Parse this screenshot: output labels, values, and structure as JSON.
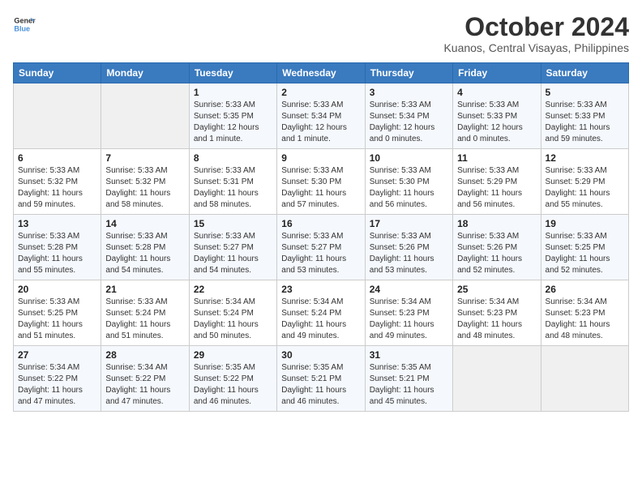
{
  "header": {
    "logo_line1": "General",
    "logo_line2": "Blue",
    "month": "October 2024",
    "location": "Kuanos, Central Visayas, Philippines"
  },
  "weekdays": [
    "Sunday",
    "Monday",
    "Tuesday",
    "Wednesday",
    "Thursday",
    "Friday",
    "Saturday"
  ],
  "weeks": [
    [
      {
        "day": "",
        "info": ""
      },
      {
        "day": "",
        "info": ""
      },
      {
        "day": "1",
        "info": "Sunrise: 5:33 AM\nSunset: 5:35 PM\nDaylight: 12 hours\nand 1 minute."
      },
      {
        "day": "2",
        "info": "Sunrise: 5:33 AM\nSunset: 5:34 PM\nDaylight: 12 hours\nand 1 minute."
      },
      {
        "day": "3",
        "info": "Sunrise: 5:33 AM\nSunset: 5:34 PM\nDaylight: 12 hours\nand 0 minutes."
      },
      {
        "day": "4",
        "info": "Sunrise: 5:33 AM\nSunset: 5:33 PM\nDaylight: 12 hours\nand 0 minutes."
      },
      {
        "day": "5",
        "info": "Sunrise: 5:33 AM\nSunset: 5:33 PM\nDaylight: 11 hours\nand 59 minutes."
      }
    ],
    [
      {
        "day": "6",
        "info": "Sunrise: 5:33 AM\nSunset: 5:32 PM\nDaylight: 11 hours\nand 59 minutes."
      },
      {
        "day": "7",
        "info": "Sunrise: 5:33 AM\nSunset: 5:32 PM\nDaylight: 11 hours\nand 58 minutes."
      },
      {
        "day": "8",
        "info": "Sunrise: 5:33 AM\nSunset: 5:31 PM\nDaylight: 11 hours\nand 58 minutes."
      },
      {
        "day": "9",
        "info": "Sunrise: 5:33 AM\nSunset: 5:30 PM\nDaylight: 11 hours\nand 57 minutes."
      },
      {
        "day": "10",
        "info": "Sunrise: 5:33 AM\nSunset: 5:30 PM\nDaylight: 11 hours\nand 56 minutes."
      },
      {
        "day": "11",
        "info": "Sunrise: 5:33 AM\nSunset: 5:29 PM\nDaylight: 11 hours\nand 56 minutes."
      },
      {
        "day": "12",
        "info": "Sunrise: 5:33 AM\nSunset: 5:29 PM\nDaylight: 11 hours\nand 55 minutes."
      }
    ],
    [
      {
        "day": "13",
        "info": "Sunrise: 5:33 AM\nSunset: 5:28 PM\nDaylight: 11 hours\nand 55 minutes."
      },
      {
        "day": "14",
        "info": "Sunrise: 5:33 AM\nSunset: 5:28 PM\nDaylight: 11 hours\nand 54 minutes."
      },
      {
        "day": "15",
        "info": "Sunrise: 5:33 AM\nSunset: 5:27 PM\nDaylight: 11 hours\nand 54 minutes."
      },
      {
        "day": "16",
        "info": "Sunrise: 5:33 AM\nSunset: 5:27 PM\nDaylight: 11 hours\nand 53 minutes."
      },
      {
        "day": "17",
        "info": "Sunrise: 5:33 AM\nSunset: 5:26 PM\nDaylight: 11 hours\nand 53 minutes."
      },
      {
        "day": "18",
        "info": "Sunrise: 5:33 AM\nSunset: 5:26 PM\nDaylight: 11 hours\nand 52 minutes."
      },
      {
        "day": "19",
        "info": "Sunrise: 5:33 AM\nSunset: 5:25 PM\nDaylight: 11 hours\nand 52 minutes."
      }
    ],
    [
      {
        "day": "20",
        "info": "Sunrise: 5:33 AM\nSunset: 5:25 PM\nDaylight: 11 hours\nand 51 minutes."
      },
      {
        "day": "21",
        "info": "Sunrise: 5:33 AM\nSunset: 5:24 PM\nDaylight: 11 hours\nand 51 minutes."
      },
      {
        "day": "22",
        "info": "Sunrise: 5:34 AM\nSunset: 5:24 PM\nDaylight: 11 hours\nand 50 minutes."
      },
      {
        "day": "23",
        "info": "Sunrise: 5:34 AM\nSunset: 5:24 PM\nDaylight: 11 hours\nand 49 minutes."
      },
      {
        "day": "24",
        "info": "Sunrise: 5:34 AM\nSunset: 5:23 PM\nDaylight: 11 hours\nand 49 minutes."
      },
      {
        "day": "25",
        "info": "Sunrise: 5:34 AM\nSunset: 5:23 PM\nDaylight: 11 hours\nand 48 minutes."
      },
      {
        "day": "26",
        "info": "Sunrise: 5:34 AM\nSunset: 5:23 PM\nDaylight: 11 hours\nand 48 minutes."
      }
    ],
    [
      {
        "day": "27",
        "info": "Sunrise: 5:34 AM\nSunset: 5:22 PM\nDaylight: 11 hours\nand 47 minutes."
      },
      {
        "day": "28",
        "info": "Sunrise: 5:34 AM\nSunset: 5:22 PM\nDaylight: 11 hours\nand 47 minutes."
      },
      {
        "day": "29",
        "info": "Sunrise: 5:35 AM\nSunset: 5:22 PM\nDaylight: 11 hours\nand 46 minutes."
      },
      {
        "day": "30",
        "info": "Sunrise: 5:35 AM\nSunset: 5:21 PM\nDaylight: 11 hours\nand 46 minutes."
      },
      {
        "day": "31",
        "info": "Sunrise: 5:35 AM\nSunset: 5:21 PM\nDaylight: 11 hours\nand 45 minutes."
      },
      {
        "day": "",
        "info": ""
      },
      {
        "day": "",
        "info": ""
      }
    ]
  ]
}
